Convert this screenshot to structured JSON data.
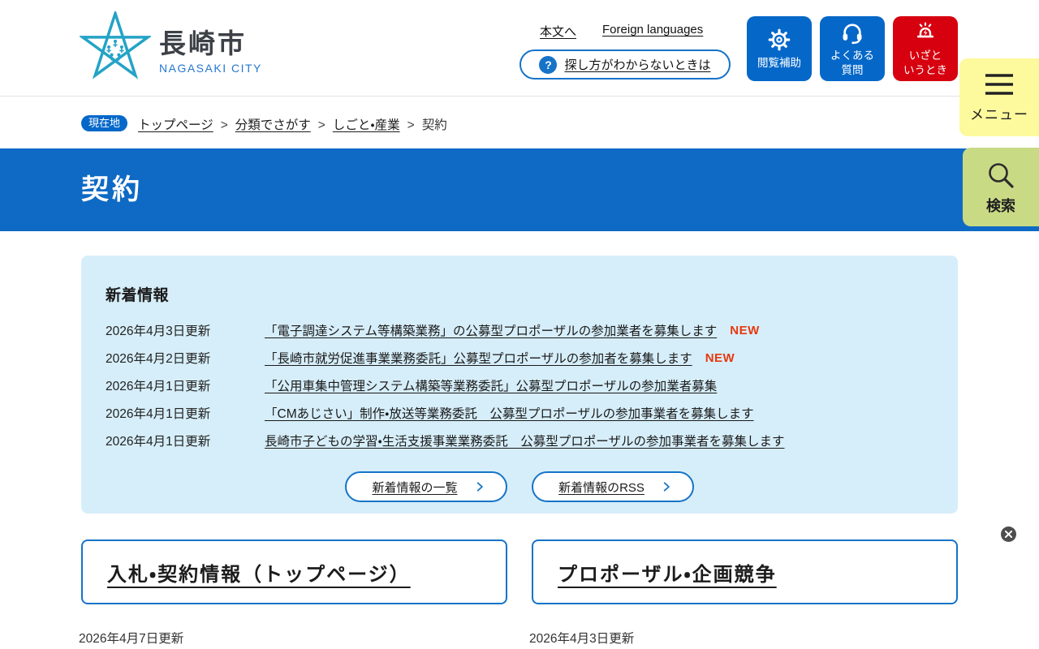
{
  "header": {
    "logo": {
      "title": "長崎市",
      "subtitle": "NAGASAKI CITY"
    },
    "links": {
      "skip": "本文へ",
      "foreign": "Foreign languages"
    },
    "help": {
      "icon": "?",
      "label": "探し方がわからないときは"
    },
    "buttons": [
      {
        "id": "accessibility",
        "label": "閲覧補助"
      },
      {
        "id": "faq",
        "label": "よくある\n質問"
      },
      {
        "id": "emergency",
        "label": "いざと\nいうとき"
      }
    ],
    "menu_label": "メニュー",
    "search_label": "検索"
  },
  "breadcrumb": {
    "badge": "現在地",
    "separator": ">",
    "items": [
      {
        "label": "トップページ",
        "link": true
      },
      {
        "label": "分類でさがす",
        "link": true
      },
      {
        "label": "しごと・産業",
        "link": true
      },
      {
        "label": "契約",
        "link": false
      }
    ]
  },
  "page_title": "契約",
  "news": {
    "heading": "新着情報",
    "new_label": "NEW",
    "items": [
      {
        "date": "2026年4月3日更新",
        "title": "「電子調達システム等構築業務」の公募型プロポーザルの参加業者を募集します",
        "new": true
      },
      {
        "date": "2026年4月2日更新",
        "title": "「長崎市就労促進事業業務委託」公募型プロポーザルの参加者を募集します",
        "new": true
      },
      {
        "date": "2026年4月1日更新",
        "title": "「公用車集中管理システム構築等業務委託」公募型プロポーザルの参加業者募集",
        "new": false
      },
      {
        "date": "2026年4月1日更新",
        "title": "「CMあじさい」制作・放送等業務委託　公募型プロポーザルの参加事業者を募集します",
        "new": false
      },
      {
        "date": "2026年4月1日更新",
        "title": "長崎市子どもの学習・生活支援事業業務委託　公募型プロポーザルの参加事業者を募集します",
        "new": false
      }
    ],
    "buttons": [
      {
        "label": "新着情報の一覧"
      },
      {
        "label": "新着情報のRSS"
      }
    ]
  },
  "cards": [
    {
      "title": "入札・契約情報（トップページ）",
      "updated": "2026年4月7日更新"
    },
    {
      "title": "プロポーザル・企画競争",
      "updated": "2026年4月3日更新"
    }
  ],
  "colors": {
    "primary_blue": "#0e6ac4",
    "button_blue": "#0568c9",
    "emergency_red": "#d6000f",
    "menu_yellow": "#fdf99d",
    "search_green": "#c9da85",
    "news_bg": "#d6eef9",
    "new_badge": "#e8380d",
    "logo_teal": "#24a3c6"
  }
}
